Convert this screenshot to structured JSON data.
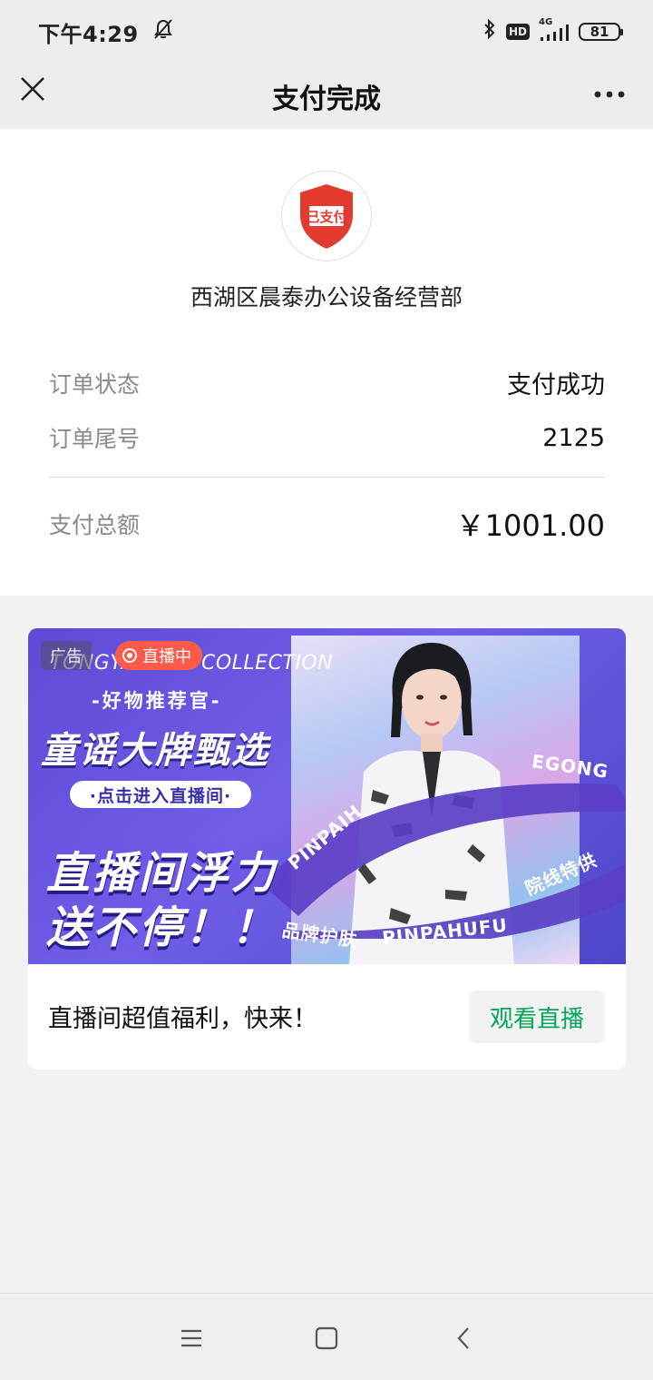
{
  "status_bar": {
    "time": "下午4:29",
    "hd": "HD",
    "network": "4G",
    "battery": "81"
  },
  "title_bar": {
    "title": "支付完成"
  },
  "receipt": {
    "logo_text": "已支付",
    "merchant_name": "西湖区晨泰办公设备经营部",
    "rows": [
      {
        "label": "订单状态",
        "value": "支付成功"
      },
      {
        "label": "订单尾号",
        "value": "2125"
      }
    ],
    "total_label": "支付总额",
    "total_value": "￥1001.00"
  },
  "ad": {
    "tag": "广告",
    "live_badge": "直播中",
    "en_title": "TONGYAO BIG COLLECTION",
    "subtitle": "-好物推荐官-",
    "main_title": "童谣大牌甄选",
    "enter_button": "·点击进入直播间·",
    "slogan_line1": "直播间浮力",
    "slogan_line2": "送不停！！",
    "ribbon_words": [
      "PINPAIH",
      "EGONG",
      "品牌护肤",
      "PINPAHUFU",
      "院线特供"
    ],
    "caption": "直播间超值福利，快来！",
    "watch_button": "观看直播"
  },
  "colors": {
    "accent_green": "#07a55b",
    "live_red": "#ff5a4a",
    "banner_purple": "#5b4bd6"
  }
}
